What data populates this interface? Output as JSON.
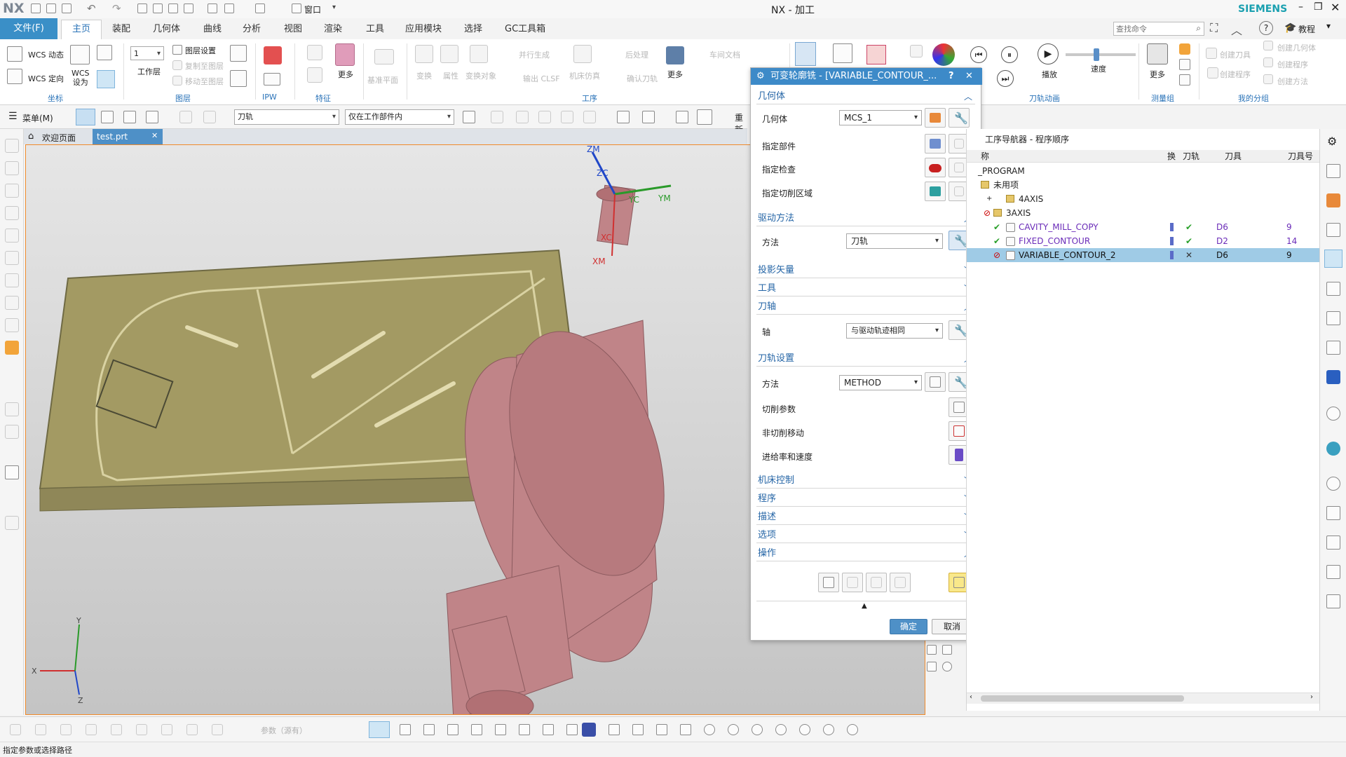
{
  "app": {
    "logo": "NX",
    "title": "NX - 加工",
    "brand": "SIEMENS",
    "tutorial": "教程",
    "search_placeholder": "查找命令",
    "window_label": "窗口"
  },
  "menu": {
    "file": "文件(F)",
    "tabs": [
      "主页",
      "装配",
      "几何体",
      "曲线",
      "分析",
      "视图",
      "渲染",
      "工具",
      "应用模块",
      "选择",
      "GC工具箱"
    ]
  },
  "ribbon": {
    "wcs_dynamic": "WCS 动态",
    "wcs_set": "WCS\n设为",
    "wcs_orient": "WCS 定向",
    "coords_group": "坐标",
    "layer_value": "1",
    "work_layer": "工作层",
    "layer_settings": "图层设置",
    "layer_copy": "复制至图层",
    "layer_move": "移动至图层",
    "layer_group": "图层",
    "ipw_group": "IPW",
    "feature_group": "特征",
    "more": "更多",
    "datum_plane": "基准平面",
    "op_items": [
      "变换",
      "属性",
      "变换对象",
      "并行生成",
      "输出 CLSF",
      "机床仿真",
      "后处理",
      "确认刀轨",
      "车间文档"
    ],
    "op_group": "工序",
    "show_path": "刀轨动画",
    "play": "播放",
    "speed": "速度",
    "measure_group": "测量组",
    "my_group": "我的分组",
    "create_tool": "创建刀具",
    "create_geometry": "创建几何体",
    "create_program": "创建程序",
    "create_method": "创建方法"
  },
  "selbar": {
    "menu": "菜单(M)",
    "filter": "刀轨",
    "scope": "仅在工作部件内",
    "reset": "重新"
  },
  "doc_tabs": {
    "welcome": "欢迎页面",
    "part": "test.prt"
  },
  "viewport": {
    "axes": {
      "zm": "ZM",
      "zc": "ZC",
      "yc": "YC",
      "ym": "YM",
      "xc": "XC",
      "xm": "XM"
    },
    "triad": {
      "x": "X",
      "y": "Y",
      "z": "Z"
    }
  },
  "dialog": {
    "title": "可变轮廓铣 - [VARIABLE_CONTOUR_...",
    "sections": {
      "geometry": "几何体",
      "drive": "驱动方法",
      "projection": "投影矢量",
      "tool": "工具",
      "axis": "刀轴",
      "path_settings": "刀轨设置",
      "machine": "机床控制",
      "program": "程序",
      "description": "描述",
      "options": "选项",
      "actions": "操作"
    },
    "geometry_label": "几何体",
    "geometry_value": "MCS_1",
    "part": "指定部件",
    "check": "指定检查",
    "cut_area": "指定切削区域",
    "method_label": "方法",
    "drive_value": "刀轨",
    "axis_label": "轴",
    "axis_value": "与驱动轨迹相同",
    "path_method_value": "METHOD",
    "cut_params": "切削参数",
    "non_cut": "非切削移动",
    "feeds": "进给率和速度",
    "ok": "确定",
    "cancel": "取消"
  },
  "navigator": {
    "title": "工序导航器 - 程序顺序",
    "columns": [
      "称",
      "换",
      "刀轨",
      "刀具",
      "刀具号"
    ],
    "rows": [
      {
        "name": "_PROGRAM",
        "tool": "",
        "num": ""
      },
      {
        "name": "未用项",
        "tool": "",
        "num": ""
      },
      {
        "name": "4AXIS",
        "tool": "",
        "num": ""
      },
      {
        "name": "3AXIS",
        "tool": "",
        "num": ""
      },
      {
        "name": "CAVITY_MILL_COPY",
        "tool": "D6",
        "num": "9"
      },
      {
        "name": "FIXED_CONTOUR",
        "tool": "D2",
        "num": "14"
      },
      {
        "name": "VARIABLE_CONTOUR_2",
        "tool": "D6",
        "num": "9"
      }
    ]
  },
  "bottombar": {
    "params": "参数（源有）"
  },
  "status": "指定参数或选择路径",
  "colors": {
    "accent": "#3a8fc7",
    "dialog_header": "#3d8ac8",
    "part": "#c08488",
    "highlight": "#9fcbe6",
    "check": "#2aa02a"
  }
}
